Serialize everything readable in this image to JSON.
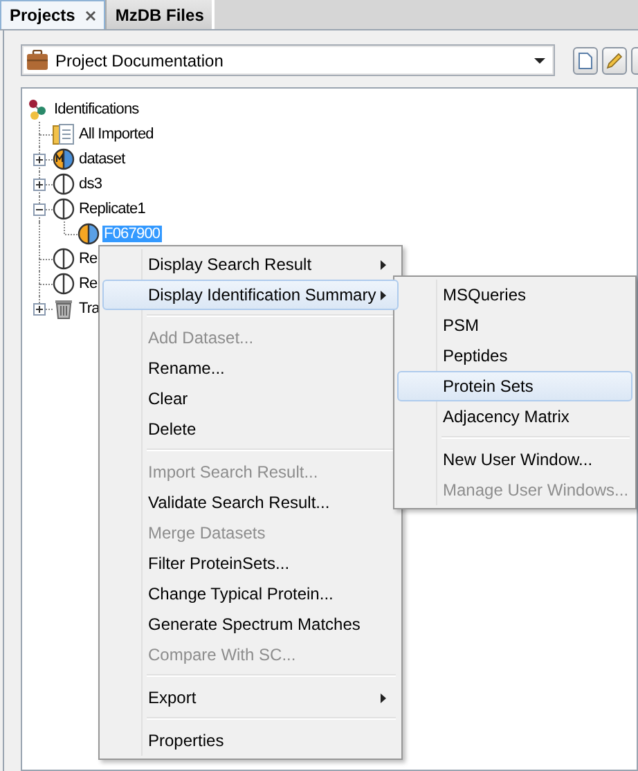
{
  "tabs": [
    {
      "label": "Projects",
      "selected": true,
      "closable": true
    },
    {
      "label": "MzDB Files",
      "selected": false,
      "closable": false
    }
  ],
  "project_selector": {
    "value": "Project Documentation"
  },
  "toolbar": [
    {
      "kind": "new"
    },
    {
      "kind": "edit"
    },
    {
      "kind": "other"
    }
  ],
  "tree": {
    "label": "Identifications",
    "kind": "root",
    "children": [
      {
        "label": "All Imported",
        "kind": "folder"
      },
      {
        "label": "dataset",
        "kind": "merged",
        "expanded": false
      },
      {
        "label": "ds3",
        "kind": "plain",
        "expanded": false
      },
      {
        "label": "Replicate1",
        "kind": "plain",
        "expanded": true,
        "children": [
          {
            "label": "F067900",
            "kind": "identified",
            "selected": true
          }
        ]
      },
      {
        "label": "Re",
        "kind": "plain"
      },
      {
        "label": "Re",
        "kind": "plain"
      },
      {
        "label": "Tra",
        "kind": "trash",
        "expanded": false
      }
    ]
  },
  "context_menu": [
    {
      "kind": "item",
      "label": "Display Search Result",
      "disabled": false,
      "selected": false,
      "submenu": true
    },
    {
      "kind": "item",
      "label": "Display Identification Summary",
      "disabled": false,
      "selected": true,
      "submenu": true
    },
    {
      "kind": "separator"
    },
    {
      "kind": "item",
      "label": "Add Dataset...",
      "disabled": true,
      "selected": false,
      "submenu": false
    },
    {
      "kind": "item",
      "label": "Rename...",
      "disabled": false,
      "selected": false,
      "submenu": false
    },
    {
      "kind": "item",
      "label": "Clear",
      "disabled": false,
      "selected": false,
      "submenu": false
    },
    {
      "kind": "item",
      "label": "Delete",
      "disabled": false,
      "selected": false,
      "submenu": false
    },
    {
      "kind": "separator"
    },
    {
      "kind": "item",
      "label": "Import Search Result...",
      "disabled": true,
      "selected": false,
      "submenu": false
    },
    {
      "kind": "item",
      "label": "Validate Search Result...",
      "disabled": false,
      "selected": false,
      "submenu": false
    },
    {
      "kind": "item",
      "label": "Merge Datasets",
      "disabled": true,
      "selected": false,
      "submenu": false
    },
    {
      "kind": "item",
      "label": "Filter ProteinSets...",
      "disabled": false,
      "selected": false,
      "submenu": false
    },
    {
      "kind": "item",
      "label": "Change Typical Protein...",
      "disabled": false,
      "selected": false,
      "submenu": false
    },
    {
      "kind": "item",
      "label": "Generate Spectrum Matches",
      "disabled": false,
      "selected": false,
      "submenu": false
    },
    {
      "kind": "item",
      "label": "Compare With SC...",
      "disabled": true,
      "selected": false,
      "submenu": false
    },
    {
      "kind": "separator"
    },
    {
      "kind": "item",
      "label": "Export",
      "disabled": false,
      "selected": false,
      "submenu": true
    },
    {
      "kind": "separator"
    },
    {
      "kind": "item",
      "label": "Properties",
      "disabled": false,
      "selected": false,
      "submenu": false
    }
  ],
  "submenu": [
    {
      "kind": "item",
      "label": "MSQueries",
      "disabled": false,
      "selected": false
    },
    {
      "kind": "item",
      "label": "PSM",
      "disabled": false,
      "selected": false
    },
    {
      "kind": "item",
      "label": "Peptides",
      "disabled": false,
      "selected": false
    },
    {
      "kind": "item",
      "label": "Protein Sets",
      "disabled": false,
      "selected": true
    },
    {
      "kind": "item",
      "label": "Adjacency Matrix",
      "disabled": false,
      "selected": false
    },
    {
      "kind": "separator"
    },
    {
      "kind": "item",
      "label": "New User Window...",
      "disabled": false,
      "selected": false
    },
    {
      "kind": "item",
      "label": "Manage User Windows...",
      "disabled": true,
      "selected": false
    }
  ]
}
